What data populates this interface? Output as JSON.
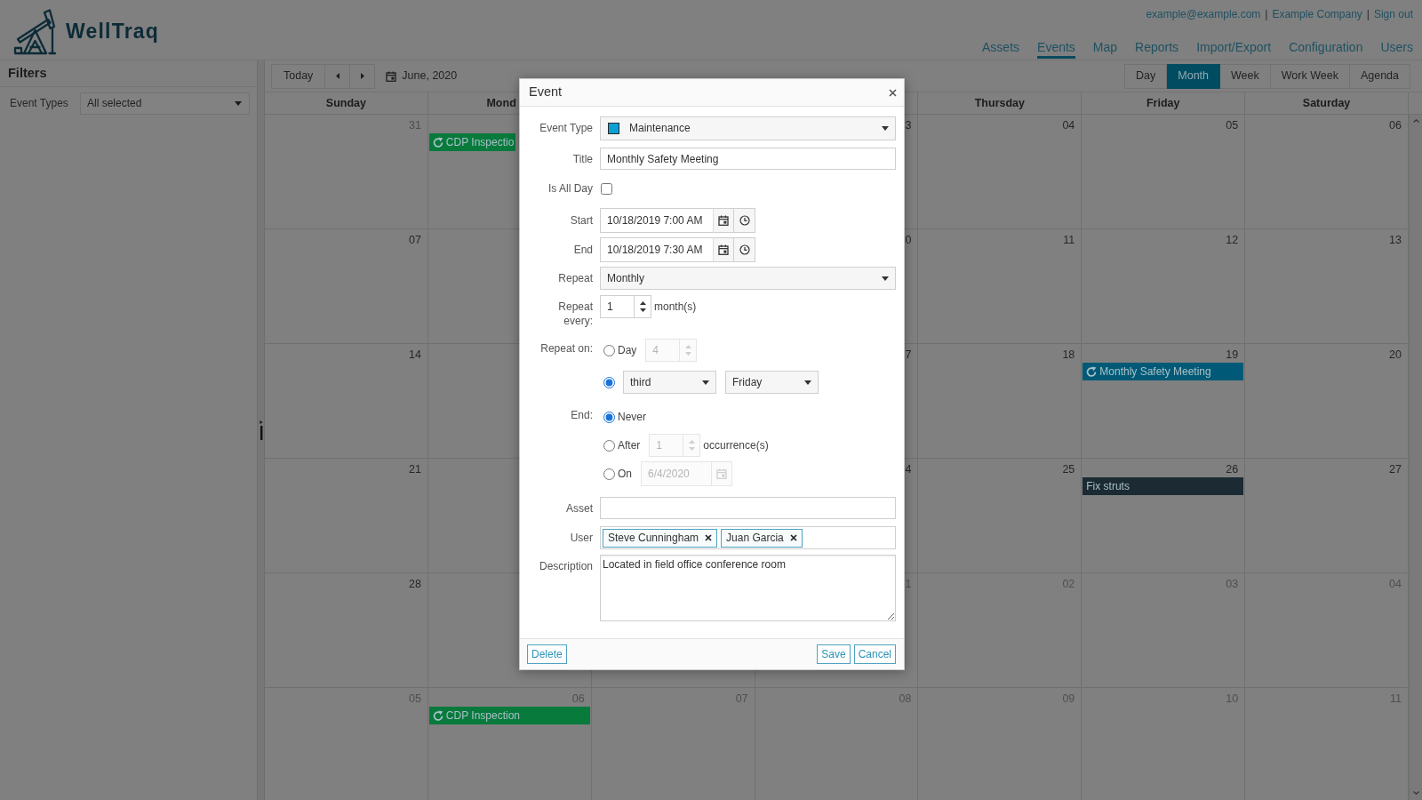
{
  "app_name": "WellTraq",
  "account_links": [
    {
      "kind": "link",
      "text": "example@example.com"
    },
    {
      "kind": "separator",
      "text": "|"
    },
    {
      "kind": "link",
      "text": "Example Company"
    },
    {
      "kind": "separator",
      "text": "|"
    },
    {
      "kind": "link",
      "text": "Sign out"
    }
  ],
  "nav": [
    {
      "label": "Assets",
      "selected": false
    },
    {
      "label": "Events",
      "selected": true
    },
    {
      "label": "Map",
      "selected": false
    },
    {
      "label": "Reports",
      "selected": false
    },
    {
      "label": "Import/Export",
      "selected": false
    },
    {
      "label": "Configuration",
      "selected": false
    },
    {
      "label": "Users",
      "selected": false
    }
  ],
  "sidebar": {
    "title": "Filters",
    "filters": [
      {
        "label": "Event Types",
        "value": "All selected"
      }
    ]
  },
  "toolbar": {
    "today": "Today",
    "date_range": "June, 2020",
    "views": [
      {
        "label": "Day",
        "selected": false
      },
      {
        "label": "Month",
        "selected": true
      },
      {
        "label": "Week",
        "selected": false
      },
      {
        "label": "Work Week",
        "selected": false
      },
      {
        "label": "Agenda",
        "selected": false
      }
    ]
  },
  "calendar": {
    "weekdays": {
      "sunday": {
        "label": "Sunday",
        "cut": false
      },
      "monday": {
        "label": "Mond",
        "cut": true
      },
      "thursday": {
        "label": "Thursday",
        "cut": false
      },
      "friday": {
        "label": "Friday",
        "cut": false
      },
      "saturday": {
        "label": "Saturday",
        "cut": false
      }
    },
    "weeks": [
      {
        "sunday": {
          "number": "31",
          "other_month": true
        },
        "monday": {
          "events": [
            {
              "title": "CDP Inspectio",
              "recurring": true,
              "cut": true,
              "color": "#077a3c"
            }
          ]
        },
        "wednesday": {
          "number": "3",
          "other_month": false
        },
        "thursday": {
          "number": "04",
          "other_month": false
        },
        "friday": {
          "number": "05",
          "other_month": false
        },
        "saturday": {
          "number": "06",
          "other_month": false
        }
      },
      {
        "sunday": {
          "number": "07",
          "other_month": false
        },
        "wednesday": {
          "number": "0",
          "other_month": false
        },
        "thursday": {
          "number": "11",
          "other_month": false
        },
        "friday": {
          "number": "12",
          "other_month": false
        },
        "saturday": {
          "number": "13",
          "other_month": false
        }
      },
      {
        "sunday": {
          "number": "14",
          "other_month": false
        },
        "wednesday": {
          "number": "7",
          "other_month": false
        },
        "thursday": {
          "number": "18",
          "other_month": false
        },
        "friday": {
          "number": "19",
          "other_month": false,
          "events": [
            {
              "title": "Monthly Safety Meeting",
              "recurring": true,
              "cut": false,
              "color": "#005a77"
            }
          ]
        },
        "saturday": {
          "number": "20",
          "other_month": false
        }
      },
      {
        "sunday": {
          "number": "21",
          "other_month": false
        },
        "wednesday": {
          "number": "4",
          "other_month": false
        },
        "thursday": {
          "number": "25",
          "other_month": false
        },
        "friday": {
          "number": "26",
          "other_month": false,
          "events": [
            {
              "title": "Fix struts",
              "recurring": false,
              "cut": false,
              "color": "#1b2a33"
            }
          ]
        },
        "saturday": {
          "number": "27",
          "other_month": false
        }
      },
      {
        "sunday": {
          "number": "28",
          "other_month": false
        },
        "wednesday": {
          "number": "1",
          "other_month": true
        },
        "thursday": {
          "number": "02",
          "other_month": true
        },
        "friday": {
          "number": "03",
          "other_month": true
        },
        "saturday": {
          "number": "04",
          "other_month": true
        }
      },
      {
        "sunday": {
          "number": "05",
          "other_month": true
        },
        "monday": {
          "number": "06",
          "other_month": true,
          "events": [
            {
              "title": "CDP Inspection",
              "recurring": true,
              "cut": false,
              "color": "#077a3c"
            }
          ]
        },
        "tuesday": {
          "number": "07",
          "other_month": true
        },
        "wednesday": {
          "number": "08",
          "other_month": true
        },
        "thursday": {
          "number": "09",
          "other_month": true
        },
        "friday": {
          "number": "10",
          "other_month": true
        },
        "saturday": {
          "number": "11",
          "other_month": true
        }
      }
    ]
  },
  "dialog": {
    "title": "Event",
    "fields": [
      {
        "kind": "type-select",
        "label": "Event Type",
        "value": "Maintenance"
      },
      {
        "kind": "text",
        "label": "Title",
        "value": "Monthly Safety Meeting"
      },
      {
        "kind": "checkbox",
        "label": "Is All Day",
        "checked": false
      },
      {
        "kind": "datetime",
        "label": "Start",
        "value": "10/18/2019 7:00 AM"
      },
      {
        "kind": "datetime",
        "label": "End",
        "value": "10/18/2019 7:30 AM"
      },
      {
        "kind": "select",
        "label": "Repeat",
        "value": "Monthly"
      },
      {
        "kind": "number",
        "label": "Repeat every:",
        "value": "1",
        "suffix": "month(s)"
      },
      {
        "kind": "radios",
        "label": "Repeat on:",
        "options": [
          {
            "kind": "number",
            "selected": false,
            "label": "Day",
            "value": "4",
            "disabled": true
          },
          {
            "kind": "selects",
            "selected": true,
            "values": [
              "third",
              "Friday"
            ],
            "disabled": false
          }
        ]
      },
      {
        "kind": "radios",
        "label": "End:",
        "options": [
          {
            "kind": "plain",
            "selected": true,
            "label": "Never",
            "disabled": false
          },
          {
            "kind": "number",
            "selected": false,
            "label": "After",
            "value": "1",
            "suffix": "occurrence(s)",
            "disabled": true
          },
          {
            "kind": "date",
            "selected": false,
            "label": "On",
            "value": "6/4/2020",
            "disabled": true
          }
        ]
      },
      {
        "kind": "text",
        "label": "Asset"
      },
      {
        "kind": "tags",
        "label": "User",
        "tags": [
          "Steve Cunningham",
          "Juan Garcia"
        ]
      },
      {
        "kind": "textarea",
        "label": "Description",
        "value": "Located in field office conference room"
      }
    ],
    "buttons_left": [
      "Delete"
    ],
    "buttons_right": [
      "Save",
      "Cancel"
    ]
  }
}
